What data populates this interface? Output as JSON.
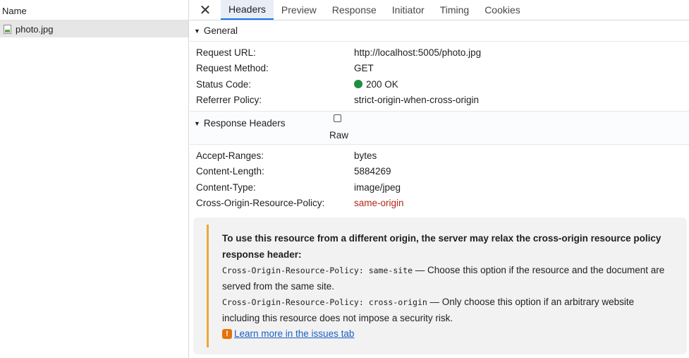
{
  "left_panel": {
    "header": "Name",
    "files": [
      {
        "name": "photo.jpg"
      }
    ]
  },
  "tabs": {
    "close_glyph": "✕",
    "items": [
      "Headers",
      "Preview",
      "Response",
      "Initiator",
      "Timing",
      "Cookies"
    ],
    "active": "Headers"
  },
  "general": {
    "title": "General",
    "rows": [
      {
        "key": "Request URL:",
        "value": "http://localhost:5005/photo.jpg"
      },
      {
        "key": "Request Method:",
        "value": "GET"
      },
      {
        "key": "Status Code:",
        "value": "200 OK"
      },
      {
        "key": "Referrer Policy:",
        "value": "strict-origin-when-cross-origin"
      }
    ],
    "status_color": "#1e8e3e"
  },
  "response_headers": {
    "title": "Response Headers",
    "raw_label": "Raw",
    "raw_checked": false,
    "rows": [
      {
        "key": "Accept-Ranges:",
        "value": "bytes"
      },
      {
        "key": "Content-Length:",
        "value": "5884269"
      },
      {
        "key": "Content-Type:",
        "value": "image/jpeg"
      },
      {
        "key": "Cross-Origin-Resource-Policy:",
        "value": "same-origin"
      }
    ],
    "highlight_color": "#b3261e"
  },
  "issue": {
    "title": "To use this resource from a different origin, the server may relax the cross-origin resource policy response header:",
    "option1_code": "Cross-Origin-Resource-Policy: same-site",
    "option1_text": " — Choose this option if the resource and the document are served from the same site.",
    "option2_code": "Cross-Origin-Resource-Policy: cross-origin",
    "option2_text": " — Only choose this option if an arbitrary website including this resource does not impose a security risk.",
    "link_icon": "!",
    "link_text": "Learn more in the issues tab",
    "accent_color": "#e8a93c"
  }
}
